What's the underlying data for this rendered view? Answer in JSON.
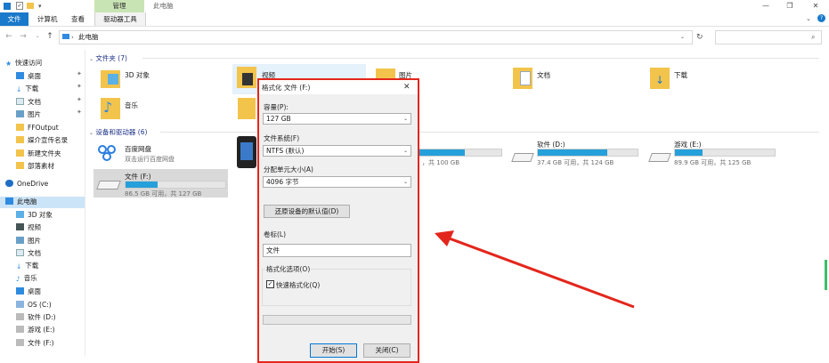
{
  "titlebar": {
    "tools_tab": "管理",
    "title": "此电脑",
    "minimize": "—",
    "restore": "❐",
    "close": "✕"
  },
  "ribbon": {
    "tabs": [
      "文件",
      "计算机",
      "查看",
      "驱动器工具"
    ]
  },
  "nav": {
    "path": "此电脑",
    "search_placeholder": ""
  },
  "sidebar": {
    "quick_access": "快速访问",
    "items": [
      "桌面",
      "下载",
      "文档",
      "图片",
      "FFOutput",
      "媒介宣传名录",
      "新建文件夹",
      "部落素材"
    ],
    "onedrive": "OneDrive",
    "this_pc": "此电脑",
    "pc_items": [
      "3D 对象",
      "视频",
      "图片",
      "文档",
      "下载",
      "音乐",
      "桌面",
      "OS (C:)",
      "软件 (D:)",
      "游戏 (E:)",
      "文件 (F:)"
    ]
  },
  "content": {
    "folders_header": "文件夹 (7)",
    "folders": [
      "3D 对象",
      "视频",
      "图片",
      "文档",
      "下载",
      "音乐"
    ],
    "devices_header": "设备和驱动器 (6)",
    "baidu": {
      "name": "百度网盘",
      "sub": "双击运行百度网盘"
    },
    "drives": [
      {
        "name": "文件 (F:)",
        "free": "86.5 GB 可用，共 127 GB",
        "used": 0.32
      },
      {
        "name": "软件 (D:)",
        "free": "37.4 GB 可用，共 124 GB",
        "used": 0.7
      },
      {
        "name": "游戏 (E:)",
        "free": "89.9 GB 可用，共 125 GB",
        "used": 0.28
      },
      {
        "name": "",
        "free": "，共 100 GB",
        "used": 0.55
      }
    ]
  },
  "dialog": {
    "title": "格式化 文件 (F:)",
    "capacity_label": "容量(P):",
    "capacity_value": "127 GB",
    "fs_label": "文件系统(F)",
    "fs_value": "NTFS (默认)",
    "alloc_label": "分配单元大小(A)",
    "alloc_value": "4096 字节",
    "restore_button": "还原设备的默认值(D)",
    "volume_label": "卷标(L)",
    "volume_value": "文件",
    "options_label": "格式化选项(O)",
    "quick_format": "快速格式化(Q)",
    "quick_format_checked": true,
    "start_button": "开始(S)",
    "close_button": "关闭(C)"
  },
  "colors": {
    "accent": "#1979ca",
    "drive_bar": "#26a0da",
    "highlight_border": "#e3261c",
    "tools_tab": "#c9e4b4"
  }
}
